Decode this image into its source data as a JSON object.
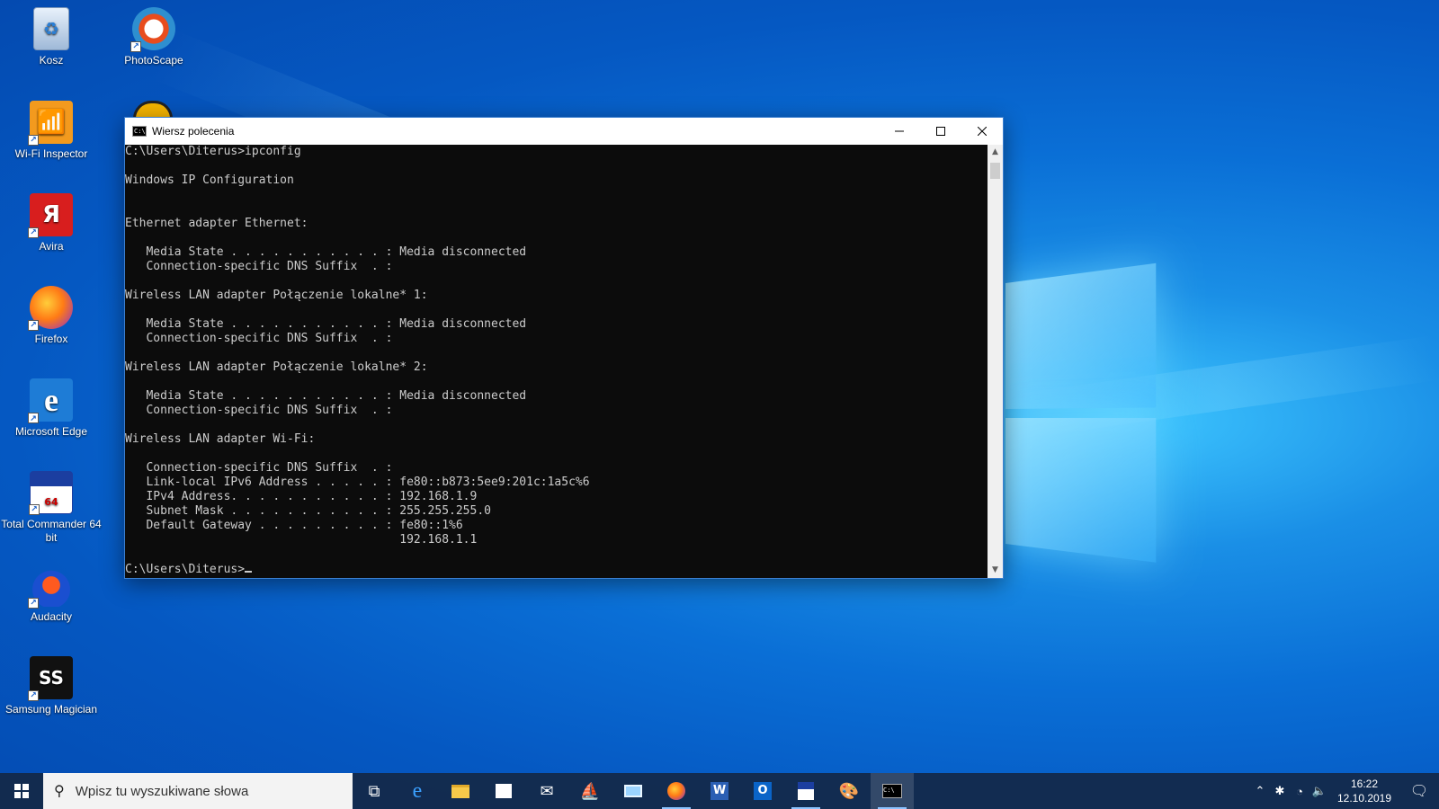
{
  "desktop": {
    "icons": [
      {
        "label": "Kosz",
        "icon": "recycle-bin-icon"
      },
      {
        "label": "PhotoScape",
        "icon": "photoscape-icon"
      },
      {
        "label": "Wi-Fi Inspector",
        "icon": "wifi-inspector-icon"
      },
      {
        "label": "Avira",
        "icon": "avira-icon"
      },
      {
        "label": "Firefox",
        "icon": "firefox-icon"
      },
      {
        "label": "Microsoft Edge",
        "icon": "edge-icon"
      },
      {
        "label": "Total Commander 64 bit",
        "icon": "total-commander-icon"
      },
      {
        "label": "Audacity",
        "icon": "audacity-icon"
      },
      {
        "label": "Samsung Magician",
        "icon": "samsung-magician-icon"
      }
    ]
  },
  "cmd": {
    "title": "Wiersz polecenia",
    "lines": [
      "C:\\Users\\Diterus>ipconfig",
      "",
      "Windows IP Configuration",
      "",
      "",
      "Ethernet adapter Ethernet:",
      "",
      "   Media State . . . . . . . . . . . : Media disconnected",
      "   Connection-specific DNS Suffix  . :",
      "",
      "Wireless LAN adapter Połączenie lokalne* 1:",
      "",
      "   Media State . . . . . . . . . . . : Media disconnected",
      "   Connection-specific DNS Suffix  . :",
      "",
      "Wireless LAN adapter Połączenie lokalne* 2:",
      "",
      "   Media State . . . . . . . . . . . : Media disconnected",
      "   Connection-specific DNS Suffix  . :",
      "",
      "Wireless LAN adapter Wi-Fi:",
      "",
      "   Connection-specific DNS Suffix  . :",
      "   Link-local IPv6 Address . . . . . : fe80::b873:5ee9:201c:1a5c%6",
      "   IPv4 Address. . . . . . . . . . . : 192.168.1.9",
      "   Subnet Mask . . . . . . . . . . . : 255.255.255.0",
      "   Default Gateway . . . . . . . . . : fe80::1%6",
      "                                       192.168.1.1",
      ""
    ],
    "prompt": "C:\\Users\\Diterus>"
  },
  "taskbar": {
    "search_placeholder": "Wpisz tu wyszukiwane słowa",
    "time": "16:22",
    "date": "12.10.2019",
    "accent": "#8cc3ff"
  }
}
